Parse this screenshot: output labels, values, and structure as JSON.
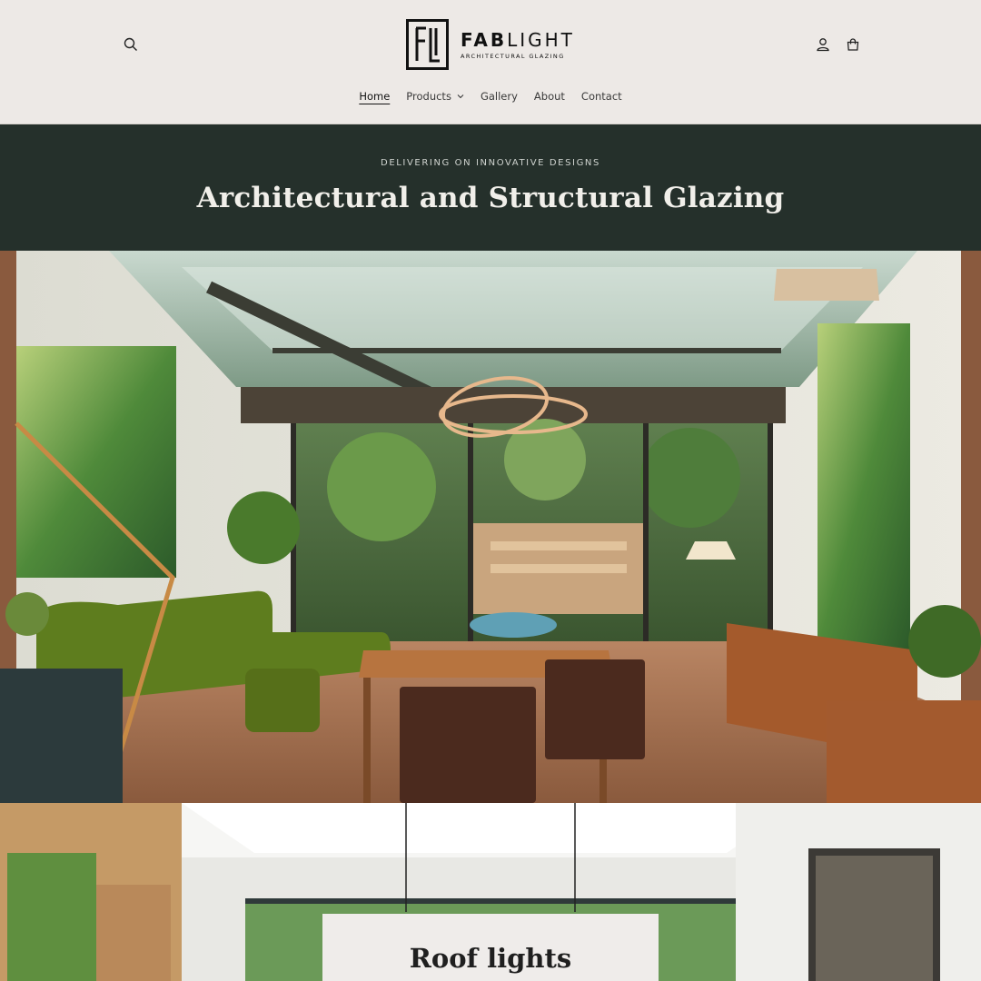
{
  "brand": {
    "name_bold": "FAB",
    "name_light": "LIGHT",
    "tagline": "ARCHITECTURAL GLAZING",
    "logo_icon": "fl-monogram-icon"
  },
  "header": {
    "search_icon": "search-icon",
    "account_icon": "account-icon",
    "cart_icon": "cart-icon"
  },
  "nav": {
    "items": [
      {
        "label": "Home",
        "active": true
      },
      {
        "label": "Products",
        "has_dropdown": true
      },
      {
        "label": "Gallery"
      },
      {
        "label": "About"
      },
      {
        "label": "Contact"
      }
    ]
  },
  "banner": {
    "subheading": "DELIVERING ON INNOVATIVE DESIGNS",
    "title": "Architectural and Structural Glazing"
  },
  "sections": {
    "roof_lights": {
      "title": "Roof lights"
    }
  },
  "colors": {
    "header_bg": "#ede9e6",
    "banner_bg": "#25302b",
    "banner_text": "#f1efea"
  }
}
